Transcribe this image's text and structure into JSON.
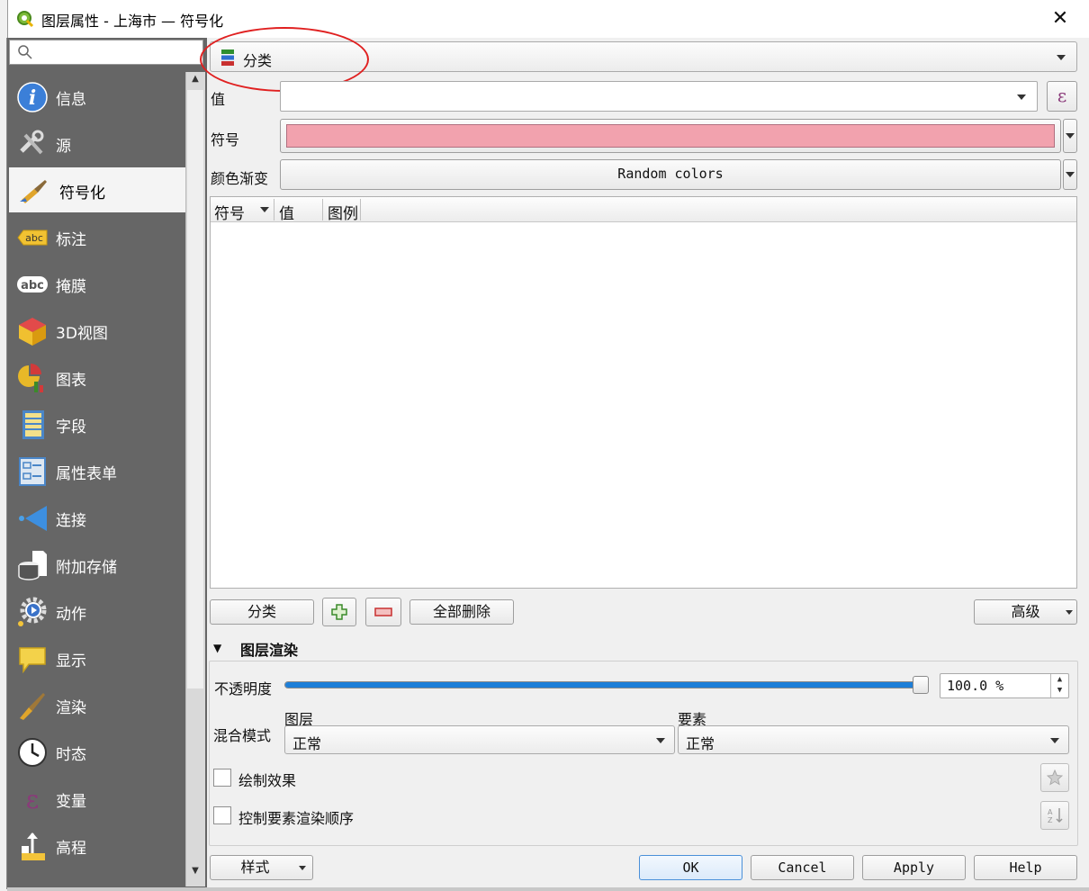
{
  "window": {
    "title": "图层属性 - 上海市 — 符号化",
    "close_glyph": "✕"
  },
  "sidebar": {
    "search_placeholder": "",
    "items": [
      {
        "label": "信息",
        "icon": "info-icon"
      },
      {
        "label": "源",
        "icon": "source-tools-icon"
      },
      {
        "label": "符号化",
        "icon": "symbology-brush-icon"
      },
      {
        "label": "标注",
        "icon": "labels-abc-icon"
      },
      {
        "label": "掩膜",
        "icon": "mask-abc-icon"
      },
      {
        "label": "3D视图",
        "icon": "3d-cube-icon"
      },
      {
        "label": "图表",
        "icon": "diagram-icon"
      },
      {
        "label": "字段",
        "icon": "fields-icon"
      },
      {
        "label": "属性表单",
        "icon": "attribute-form-icon"
      },
      {
        "label": "连接",
        "icon": "joins-icon"
      },
      {
        "label": "附加存储",
        "icon": "auxiliary-storage-icon"
      },
      {
        "label": "动作",
        "icon": "actions-gear-icon"
      },
      {
        "label": "显示",
        "icon": "display-bubble-icon"
      },
      {
        "label": "渲染",
        "icon": "rendering-brush-icon"
      },
      {
        "label": "时态",
        "icon": "temporal-clock-icon"
      },
      {
        "label": "变量",
        "icon": "variables-epsilon-icon"
      },
      {
        "label": "高程",
        "icon": "elevation-icon"
      }
    ],
    "active_index": 2
  },
  "renderer": {
    "type_label": "分类"
  },
  "value_row": {
    "label": "值",
    "value": "",
    "expr_glyph": "ε"
  },
  "symbol_row": {
    "label": "符号",
    "color": "#f2a2ae"
  },
  "ramp_row": {
    "label": "颜色渐变",
    "value": "Random colors"
  },
  "table": {
    "headers": [
      "符号",
      "值",
      "图例"
    ],
    "rows": []
  },
  "actions": {
    "classify": "分类",
    "delete_all": "全部删除",
    "advanced": "高级"
  },
  "layer_rendering": {
    "title": "图层渲染",
    "opacity_label": "不透明度",
    "opacity_value": "100.0 %",
    "opacity_fraction": 1.0,
    "blend_label": "混合模式",
    "layer_label": "图层",
    "layer_value": "正常",
    "feature_label": "要素",
    "feature_value": "正常",
    "draw_effects": "绘制效果",
    "feature_order": "控制要素渲染顺序"
  },
  "footer": {
    "style": "样式",
    "ok": "OK",
    "cancel": "Cancel",
    "apply": "Apply",
    "help": "Help"
  },
  "colors": {
    "sidebar_bg": "#666666",
    "highlight_oval": "#e02020",
    "slider": "#1e7fd8"
  }
}
